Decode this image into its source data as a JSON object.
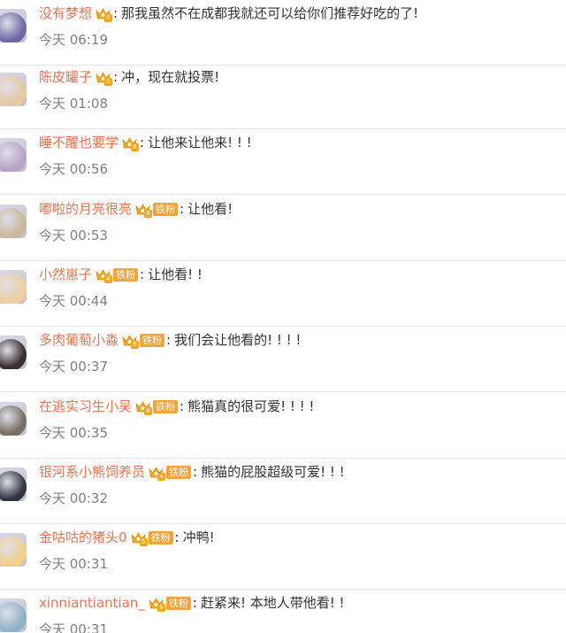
{
  "comments": [
    {
      "user": "没有梦想",
      "crown_level": "6",
      "fan_badge": "",
      "text": "那我虽然不在成都我就还可以给你们推荐好吃的了!",
      "time": "今天 06:19",
      "avatar_color": "#6d6aa8"
    },
    {
      "user": "陈皮罐子",
      "crown_level": "5",
      "fan_badge": "",
      "text": "冲，现在就投票!",
      "time": "今天 01:08",
      "avatar_color": "#e8c9a0"
    },
    {
      "user": "睡不醒也要学",
      "crown_level": "6",
      "fan_badge": "",
      "text": "让他来让他来! ! !",
      "time": "今天 00:56",
      "avatar_color": "#b9a3c9"
    },
    {
      "user": "嘟啦的月亮很亮",
      "crown_level": "6",
      "fan_badge": "铁粉",
      "text": "让他看!",
      "time": "今天 00:53",
      "avatar_color": "#c9b89a"
    },
    {
      "user": "小然崽子",
      "crown_level": "4",
      "fan_badge": "铁粉",
      "text": "让他看! !",
      "time": "今天 00:44",
      "avatar_color": "#f0cfa0"
    },
    {
      "user": "多肉葡萄小淼",
      "crown_level": "6",
      "fan_badge": "铁粉",
      "text": "我们会让他看的! ! ! !",
      "time": "今天 00:37",
      "avatar_color": "#3a2f2f"
    },
    {
      "user": "在逃实习生小吴",
      "crown_level": "6",
      "fan_badge": "铁粉",
      "text": "熊猫真的很可爱! ! ! !",
      "time": "今天 00:35",
      "avatar_color": "#7a7064"
    },
    {
      "user": "银河系小熊饲养员",
      "crown_level": "4",
      "fan_badge": "铁粉",
      "text": "熊猫的屁股超级可爱! ! !",
      "time": "今天 00:32",
      "avatar_color": "#2f3542"
    },
    {
      "user": "金咕咕的猪头0",
      "crown_level": "5",
      "fan_badge": "铁粉",
      "text": "冲鸭!",
      "time": "今天 00:31",
      "avatar_color": "#f3d08a"
    },
    {
      "user": "xinniantiantian_",
      "crown_level": "6",
      "fan_badge": "铁粉",
      "text": "赶紧来! 本地人带他看! !",
      "time": "今天 00:31",
      "avatar_color": "#8fb3c8"
    }
  ],
  "colors": {
    "username": "#eb7350",
    "text": "#333333",
    "time": "#808080",
    "crown": "#f5a623",
    "fan_badge_bg": "#f8a23a",
    "divider": "#e6e6e6"
  },
  "icons": {
    "crown": "crown-icon"
  }
}
